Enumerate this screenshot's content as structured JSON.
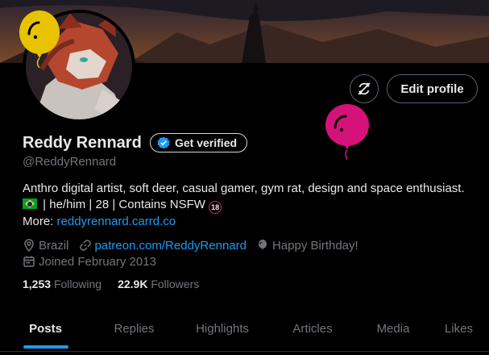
{
  "profile": {
    "name": "Reddy Rennard",
    "handle": "@ReddyRennard",
    "get_verified": "Get verified",
    "edit_profile": "Edit profile",
    "bio_line1": "Anthro digital artist, soft deer, casual gamer, gym rat, design and space enthusiast.",
    "bio_line2": "| he/him | 28 | Contains NSFW",
    "bio_more_label": "More:",
    "bio_link": "reddyrennard.carrd.co",
    "badge_18": "18",
    "location": "Brazil",
    "website": "patreon.com/ReddyRennard",
    "birthday": "Happy Birthday!",
    "joined": "Joined February 2013",
    "following_count": "1,253",
    "following_label": "Following",
    "followers_count": "22.9K",
    "followers_label": "Followers"
  },
  "tabs": [
    {
      "label": "Posts"
    },
    {
      "label": "Replies"
    },
    {
      "label": "Highlights"
    },
    {
      "label": "Articles"
    },
    {
      "label": "Media"
    },
    {
      "label": "Likes"
    }
  ],
  "colors": {
    "accent": "#1d9bf0",
    "background": "#000000",
    "balloon_yellow": "#e8c400",
    "balloon_pink": "#d4127a"
  },
  "icons": [
    "location-icon",
    "link-icon",
    "balloon-icon",
    "calendar-icon",
    "verified-icon",
    "refresh-off-icon"
  ]
}
